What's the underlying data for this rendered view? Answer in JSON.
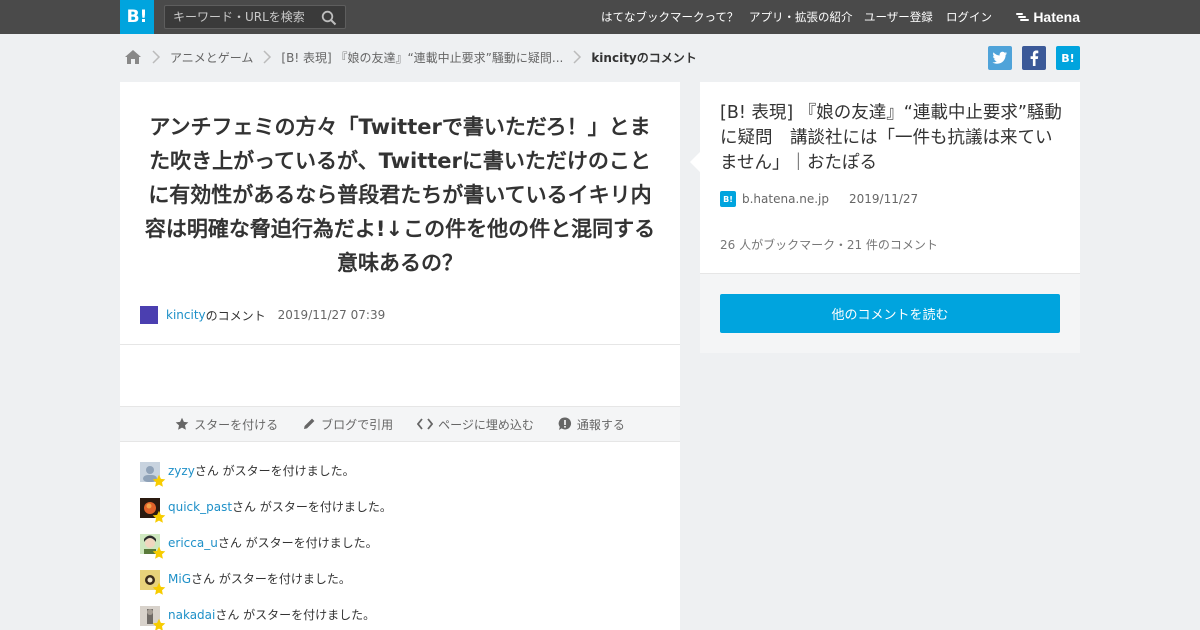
{
  "header": {
    "logo_text": "B!",
    "search_placeholder": "キーワード・URLを検索",
    "nav": [
      "はてなブックマークって？",
      "アプリ・拡張の紹介",
      "ユーザー登録",
      "ログイン"
    ],
    "hatena_label": "Hatena"
  },
  "breadcrumb": {
    "items": [
      "アニメとゲーム",
      "[B! 表現] 『娘の友達』“連載中止要求”騒動に疑問...",
      "kincityのコメント"
    ]
  },
  "share": {
    "twitter": "twitter-icon",
    "facebook": "facebook-icon",
    "hatena": "B!"
  },
  "comment": {
    "text": "アンチフェミの方々「Twitterで書いただろ！」とまた吹き上がっているが、Twitterに書いただけのことに有効性があるなら普段君たちが書いているイキリ内容は明確な脅迫行為だよ!↓この件を他の件と混同する意味あるの？",
    "user": "kincity",
    "user_suffix": "のコメント",
    "timestamp": "2019/11/27 07:39"
  },
  "actions": [
    {
      "label": "スターを付ける",
      "icon": "star-icon"
    },
    {
      "label": "ブログで引用",
      "icon": "pencil-icon"
    },
    {
      "label": "ページに埋め込む",
      "icon": "code-icon"
    },
    {
      "label": "通報する",
      "icon": "alert-icon"
    }
  ],
  "stars": {
    "suffix": "さん がスターを付けました。",
    "users": [
      {
        "name": "zyzy",
        "avatar_color": "#a9b7c8"
      },
      {
        "name": "quick_past",
        "avatar_color": "#c94a1c"
      },
      {
        "name": "ericca_u",
        "avatar_color": "#5a7a3a"
      },
      {
        "name": "MiG",
        "avatar_color": "#5c4a2a"
      },
      {
        "name": "nakadai",
        "avatar_color": "#b8b0a8"
      }
    ]
  },
  "entry": {
    "title": "[B! 表現] 『娘の友達』“連載中止要求”騒動に疑問　講談社には「一件も抗議は来ていません」｜おたぽる",
    "domain": "b.hatena.ne.jp",
    "date": "2019/11/27",
    "count_text": "26 人がブックマーク・21 件のコメント",
    "button_label": "他のコメントを読む"
  },
  "colors": {
    "accent": "#00a4de",
    "link": "#1e90c8",
    "topbar": "#4a4a4a",
    "twitter": "#4fa3d9",
    "facebook": "#3b5998",
    "star": "#f7cc00"
  }
}
